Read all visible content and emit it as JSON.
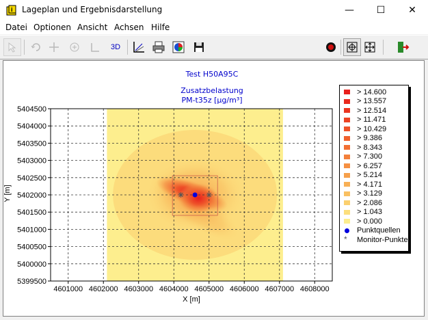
{
  "window": {
    "title": "Lageplan und Ergebnisdarstellung",
    "minimize": "—",
    "maximize": "☐",
    "close": "✕"
  },
  "menu": [
    "Datei",
    "Optionen",
    "Ansicht",
    "Achsen",
    "Hilfe"
  ],
  "toolbar": {
    "three_d_label": "3D",
    "buttons": [
      "select-tool",
      "rotate-tool",
      "move-tool",
      "zoom-tool",
      "measure-tool",
      "3d-view",
      "axis-settings",
      "print",
      "color-legend",
      "save",
      "record",
      "zoom-fit",
      "pan",
      "exit"
    ]
  },
  "plot": {
    "title": "Test H50A95C",
    "subtitle_line1": "Zusatzbelastung",
    "subtitle_line2": "PM-t35z [µg/m³]",
    "xlabel": "X [m]",
    "ylabel": "Y [m]",
    "x_ticks": [
      "4601000",
      "4602000",
      "4603000",
      "4604000",
      "4605000",
      "4606000",
      "4607000",
      "4608000"
    ],
    "y_ticks": [
      "5404500",
      "5404000",
      "5403500",
      "5403000",
      "5402500",
      "5402000",
      "5401500",
      "5401000",
      "5400500",
      "5400000",
      "5399500"
    ]
  },
  "legend": {
    "entries": [
      {
        "label": "> 14.600",
        "color": "#e8201c"
      },
      {
        "label": "> 13.557",
        "color": "#e9291d"
      },
      {
        "label": "> 12.514",
        "color": "#eb3520"
      },
      {
        "label": "> 11.471",
        "color": "#ec4324"
      },
      {
        "label": "> 10.429",
        "color": "#ee5229"
      },
      {
        "label": "> 9.386",
        "color": "#f0612e"
      },
      {
        "label": "> 8.343",
        "color": "#f27034"
      },
      {
        "label": "> 7.300",
        "color": "#f3803b"
      },
      {
        "label": "> 6.257",
        "color": "#f59043"
      },
      {
        "label": "> 5.214",
        "color": "#f6a04c"
      },
      {
        "label": "> 4.171",
        "color": "#f8b056"
      },
      {
        "label": "> 3.129",
        "color": "#f9c062"
      },
      {
        "label": "> 2.086",
        "color": "#fbd06f"
      },
      {
        "label": "> 1.043",
        "color": "#fcdf7d"
      },
      {
        "label": "> 0.000",
        "color": "#fdee8e"
      }
    ],
    "punktquellen": "Punktquellen",
    "monitor": "Monitor-Punkte"
  },
  "chart_data": {
    "type": "heatmap",
    "title": "Test H50A95C",
    "subtitle": "Zusatzbelastung PM-t35z [µg/m³]",
    "xlabel": "X [m]",
    "ylabel": "Y [m]",
    "xlim": [
      4600500,
      4608500
    ],
    "ylim": [
      5399500,
      5404500
    ],
    "grid": true,
    "legend_position": "right",
    "domain_extent": {
      "x": [
        4602100,
        4607100
      ],
      "y": [
        5399500,
        5404500
      ]
    },
    "point_sources": [
      [
        4604600,
        5402000
      ]
    ],
    "monitor_points": [
      [
        4604200,
        5402000
      ],
      [
        4605000,
        5402000
      ]
    ],
    "levels": [
      0.0,
      1.043,
      2.086,
      3.129,
      4.171,
      5.214,
      6.257,
      7.3,
      8.343,
      9.386,
      10.429,
      11.471,
      12.514,
      13.557,
      14.6
    ]
  }
}
